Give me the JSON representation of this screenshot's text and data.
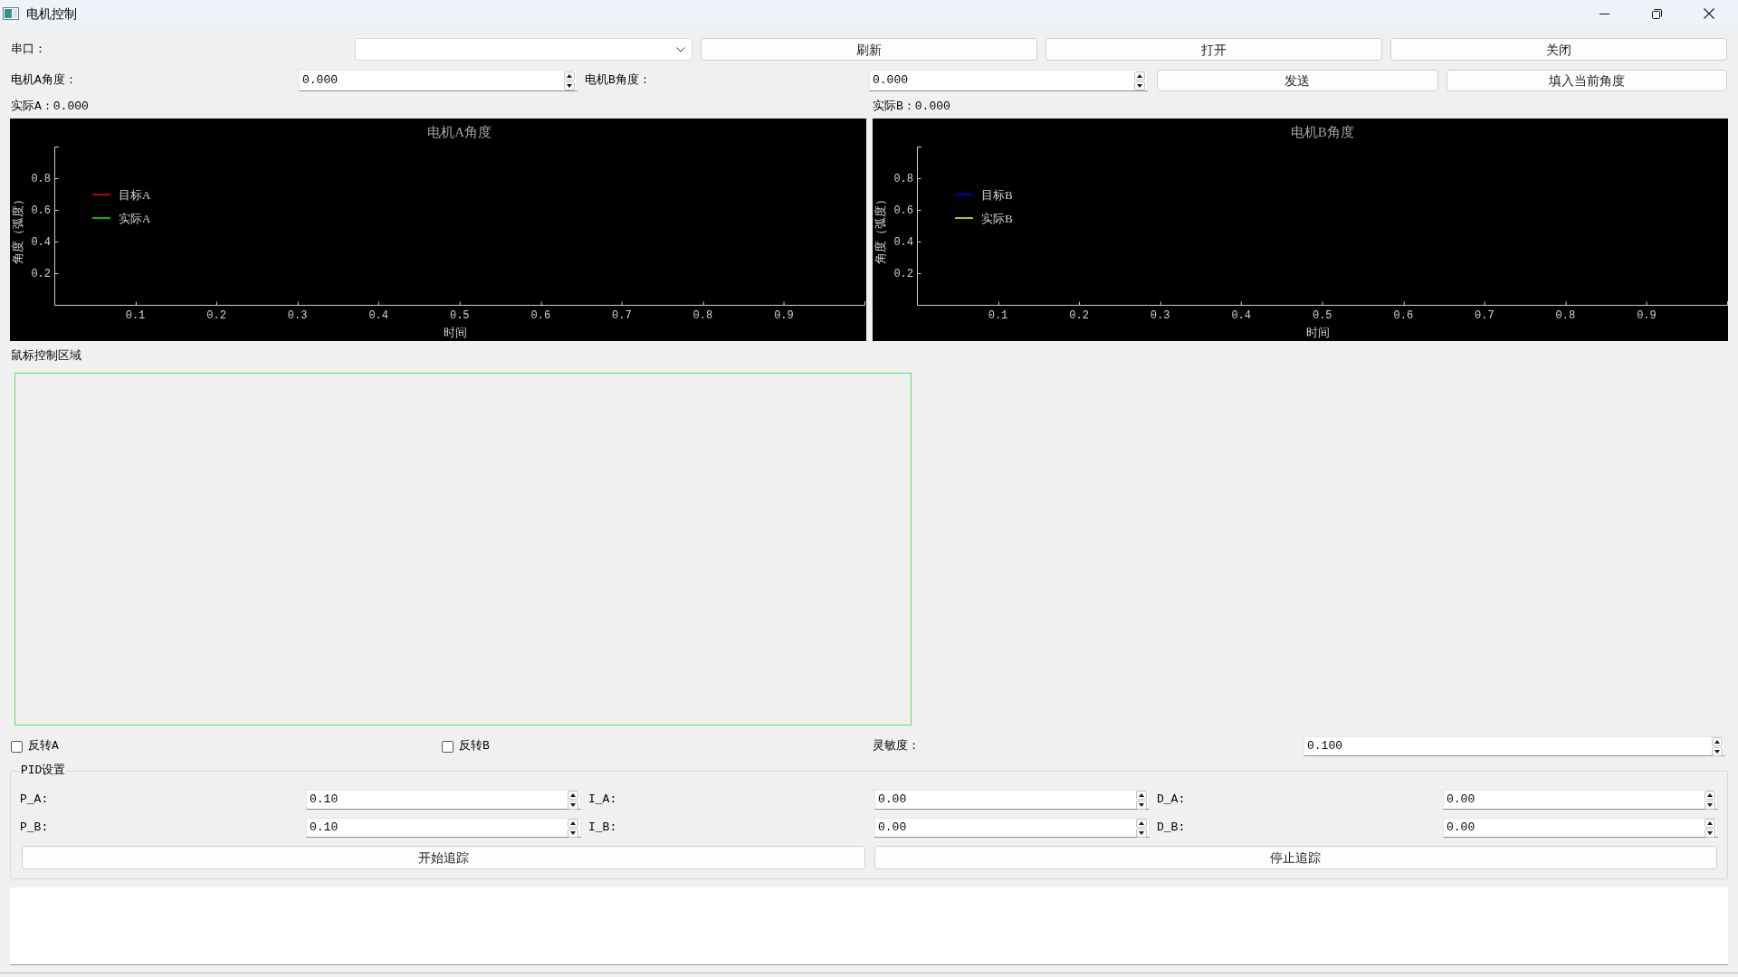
{
  "window": {
    "title": "电机控制"
  },
  "serial": {
    "label": "串口：",
    "buttons": [
      {
        "label": "刷新"
      },
      {
        "label": "打开"
      },
      {
        "label": "关闭"
      }
    ]
  },
  "angles": {
    "fields": [
      {
        "label": "电机A角度：",
        "value": "0.000"
      },
      {
        "label": "电机B角度：",
        "value": "0.000"
      }
    ],
    "buttons": [
      {
        "label": "发送"
      },
      {
        "label": "填入当前角度"
      }
    ]
  },
  "readouts": [
    "实际A：0.000",
    "实际B：0.000"
  ],
  "charts": [
    {
      "chart_data": {
        "type": "line",
        "title": "电机A角度",
        "xlabel": "时间",
        "ylabel": "角度（弧度）",
        "categories": [
          "0.1",
          "0.2",
          "0.3",
          "0.4",
          "0.5",
          "0.6",
          "0.7",
          "0.8",
          "0.9"
        ],
        "ylim": [
          0,
          1
        ],
        "yticks": [
          0.2,
          0.4,
          0.6,
          0.8
        ],
        "series": [
          {
            "name": "目标A",
            "color": "#ff0000",
            "values": [
              null,
              null,
              null,
              null,
              null,
              null,
              null,
              null,
              null
            ]
          },
          {
            "name": "实际A",
            "color": "#00ff00",
            "values": [
              null,
              null,
              null,
              null,
              null,
              null,
              null,
              null,
              null
            ]
          }
        ]
      }
    },
    {
      "chart_data": {
        "type": "line",
        "title": "电机B角度",
        "xlabel": "时间",
        "ylabel": "角度（弧度）",
        "categories": [
          "0.1",
          "0.2",
          "0.3",
          "0.4",
          "0.5",
          "0.6",
          "0.7",
          "0.8",
          "0.9"
        ],
        "ylim": [
          0,
          1
        ],
        "yticks": [
          0.2,
          0.4,
          0.6,
          0.8
        ],
        "series": [
          {
            "name": "目标B",
            "color": "#0000ff",
            "values": [
              null,
              null,
              null,
              null,
              null,
              null,
              null,
              null,
              null
            ]
          },
          {
            "name": "实际B",
            "color": "#ffff00",
            "values": [
              null,
              null,
              null,
              null,
              null,
              null,
              null,
              null,
              null
            ]
          }
        ]
      }
    }
  ],
  "mouse_area": {
    "label": "鼠标控制区域"
  },
  "options": {
    "checkboxes": [
      {
        "label": "反转A",
        "checked": false
      },
      {
        "label": "反转B",
        "checked": false
      }
    ],
    "sensitivity": {
      "label": "灵敏度：",
      "value": "0.100"
    }
  },
  "pid": {
    "title": "PID设置",
    "rows": [
      {
        "fields": [
          {
            "label": "P_A:",
            "value": "0.10"
          },
          {
            "label": "I_A:",
            "value": "0.00"
          },
          {
            "label": "D_A:",
            "value": "0.00"
          }
        ]
      },
      {
        "fields": [
          {
            "label": "P_B:",
            "value": "0.10"
          },
          {
            "label": "I_B:",
            "value": "0.00"
          },
          {
            "label": "D_B:",
            "value": "0.00"
          }
        ]
      }
    ],
    "buttons": [
      {
        "label": "开始追踪"
      },
      {
        "label": "停止追踪"
      }
    ]
  }
}
